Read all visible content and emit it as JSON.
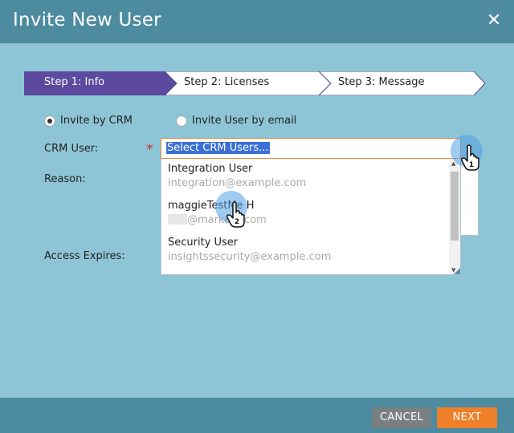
{
  "dialog": {
    "title": "Invite New User",
    "close_icon": "close-icon"
  },
  "stepper": {
    "steps": [
      {
        "label": "Step 1: Info",
        "active": true
      },
      {
        "label": "Step 2: Licenses",
        "active": false
      },
      {
        "label": "Step 3: Message",
        "active": false
      }
    ],
    "active_color": "#5b4aa0"
  },
  "invite_mode": {
    "options": [
      {
        "label": "Invite by CRM",
        "checked": true
      },
      {
        "label": "Invite User by email",
        "checked": false
      }
    ]
  },
  "form": {
    "crm_user_label": "CRM User:",
    "required_marker": "*",
    "reason_label": "Reason:",
    "access_expires_label": "Access Expires:",
    "crm_select": {
      "value": "Select CRM Users...",
      "options": [
        {
          "name": "Integration User",
          "email": "integration@example.com"
        },
        {
          "name": "maggieTestMe H",
          "email": "@marketo.com"
        },
        {
          "name": "Security User",
          "email": "insightssecurity@example.com"
        }
      ]
    }
  },
  "callouts": [
    {
      "number": "1",
      "icon": "hand-pointer-icon"
    },
    {
      "number": "2",
      "icon": "hand-pointer-icon"
    }
  ],
  "footer": {
    "cancel_label": "CANCEL",
    "next_label": "NEXT"
  },
  "colors": {
    "header": "#4d8ba0",
    "background": "#8ec5d6",
    "next_button": "#f07f2a",
    "cancel_button": "#7a7f82"
  }
}
